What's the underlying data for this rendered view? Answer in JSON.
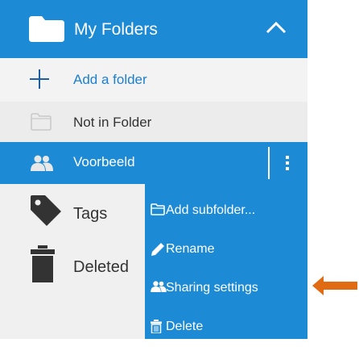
{
  "header": {
    "title": "My Folders"
  },
  "add_folder": {
    "label": "Add a folder"
  },
  "folders": {
    "not_in_folder": "Not in Folder",
    "selected": "Voorbeeld",
    "tags": "Tags",
    "deleted": "Deleted"
  },
  "context_menu": {
    "items": [
      {
        "label": "Add subfolder..."
      },
      {
        "label": "Rename"
      },
      {
        "label": "Sharing settings"
      },
      {
        "label": "Delete"
      }
    ]
  },
  "colors": {
    "accent": "#1d8ad6",
    "panel_bg": "#f0f0f0",
    "arrow": "#e06b12"
  },
  "icons": [
    "folder-icon",
    "chevron-up-icon",
    "plus-icon",
    "empty-folder-icon",
    "users-icon",
    "more-vertical-icon",
    "tag-icon",
    "trash-icon",
    "folder-outline-icon",
    "pencil-icon",
    "users-icon",
    "trash-icon",
    "arrow-left-icon"
  ]
}
